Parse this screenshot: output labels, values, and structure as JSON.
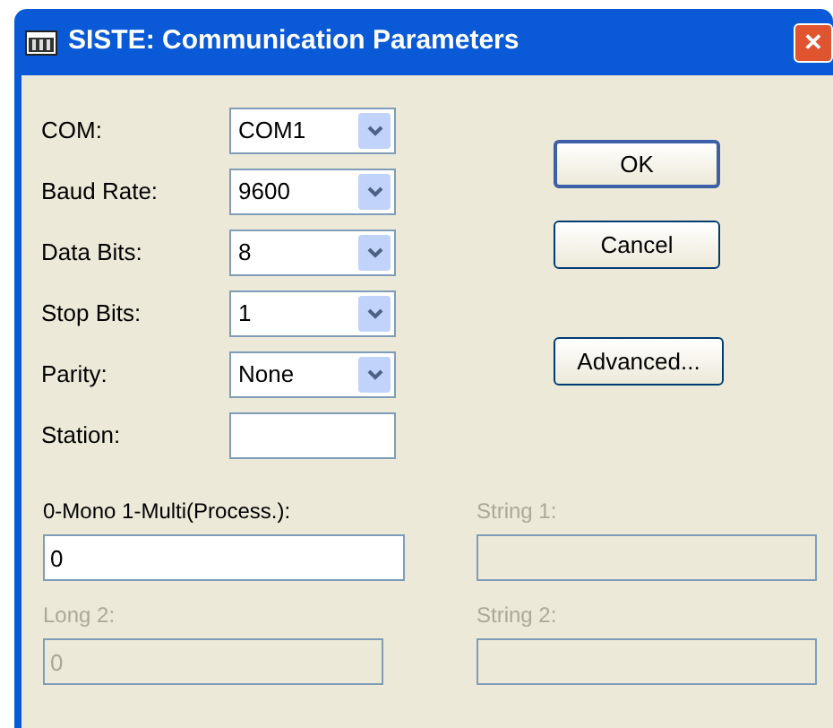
{
  "window": {
    "title": "SISTE: Communication Parameters",
    "close": "✕"
  },
  "fields": [
    {
      "label": "COM:",
      "kind": "combo",
      "value": "COM1"
    },
    {
      "label": "Baud Rate:",
      "kind": "combo",
      "value": "9600"
    },
    {
      "label": "Data Bits:",
      "kind": "combo",
      "value": "8"
    },
    {
      "label": "Stop Bits:",
      "kind": "combo",
      "value": "1"
    },
    {
      "label": "Parity:",
      "kind": "combo",
      "value": "None"
    },
    {
      "label": "Station:",
      "kind": "text"
    }
  ],
  "buttons": [
    {
      "label": "OK",
      "default": true
    },
    {
      "label": "Cancel",
      "default": false
    },
    {
      "label": "Advanced...",
      "default": false
    }
  ],
  "extra_fields": [
    {
      "label": "0-Mono 1-Multi(Process.):",
      "value": "0",
      "disabled": false
    },
    {
      "label": "String 1:",
      "disabled": true
    },
    {
      "label": "Long 2:",
      "value": "0",
      "disabled": true
    },
    {
      "label": "String 2:",
      "disabled": true
    }
  ]
}
